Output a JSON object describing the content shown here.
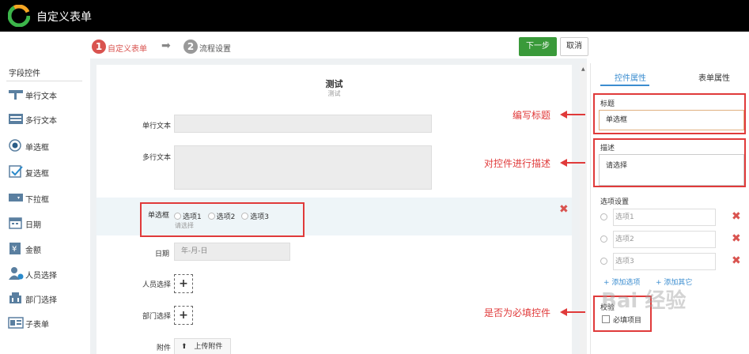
{
  "app": {
    "title": "自定义表单"
  },
  "steps": [
    {
      "num": "1",
      "label": "自定义表单"
    },
    {
      "num": "2",
      "label": "流程设置"
    }
  ],
  "toolbar": {
    "next_label": "下一步",
    "cancel_label": "取消"
  },
  "sidebar": {
    "title": "字段控件",
    "items": [
      {
        "label": "单行文本",
        "icon": "text-line-icon"
      },
      {
        "label": "多行文本",
        "icon": "text-multiline-icon"
      },
      {
        "label": "单选框",
        "icon": "radio-icon"
      },
      {
        "label": "复选框",
        "icon": "checkbox-icon"
      },
      {
        "label": "下拉框",
        "icon": "dropdown-icon"
      },
      {
        "label": "日期",
        "icon": "calendar-icon"
      },
      {
        "label": "金额",
        "icon": "money-icon"
      },
      {
        "label": "人员选择",
        "icon": "person-icon"
      },
      {
        "label": "部门选择",
        "icon": "department-icon"
      },
      {
        "label": "子表单",
        "icon": "subform-icon"
      }
    ]
  },
  "form": {
    "title": "测试",
    "subtitle": "测试",
    "fields": {
      "single_text": "单行文本",
      "multi_text": "多行文本",
      "radio": "单选框",
      "radio_options": [
        "选项1",
        "选项2",
        "选项3"
      ],
      "radio_hint": "请选择",
      "date": "日期",
      "date_placeholder": "年-月-日",
      "person": "人员选择",
      "department": "部门选择",
      "attachment": "附件",
      "upload_label": "上传附件"
    }
  },
  "panel": {
    "tabs": [
      "控件属性",
      "表单属性"
    ],
    "title_label": "标题",
    "title_value": "单选框",
    "desc_label": "描述",
    "desc_value": "请选择",
    "options_label": "选项设置",
    "options": [
      "选项1",
      "选项2",
      "选项3"
    ],
    "add_option": "+ 添加选项",
    "add_other": "+ 添加其它",
    "validation_label": "校验",
    "required_label": "必填项目"
  },
  "annotations": {
    "title": "编写标题",
    "desc": "对控件进行描述",
    "required": "是否为必填控件"
  },
  "watermark": "Bai 经验",
  "colors": {
    "accent_red": "#d9534f",
    "next_green": "#3a9a3a",
    "tab_blue": "#3b8dd0"
  }
}
